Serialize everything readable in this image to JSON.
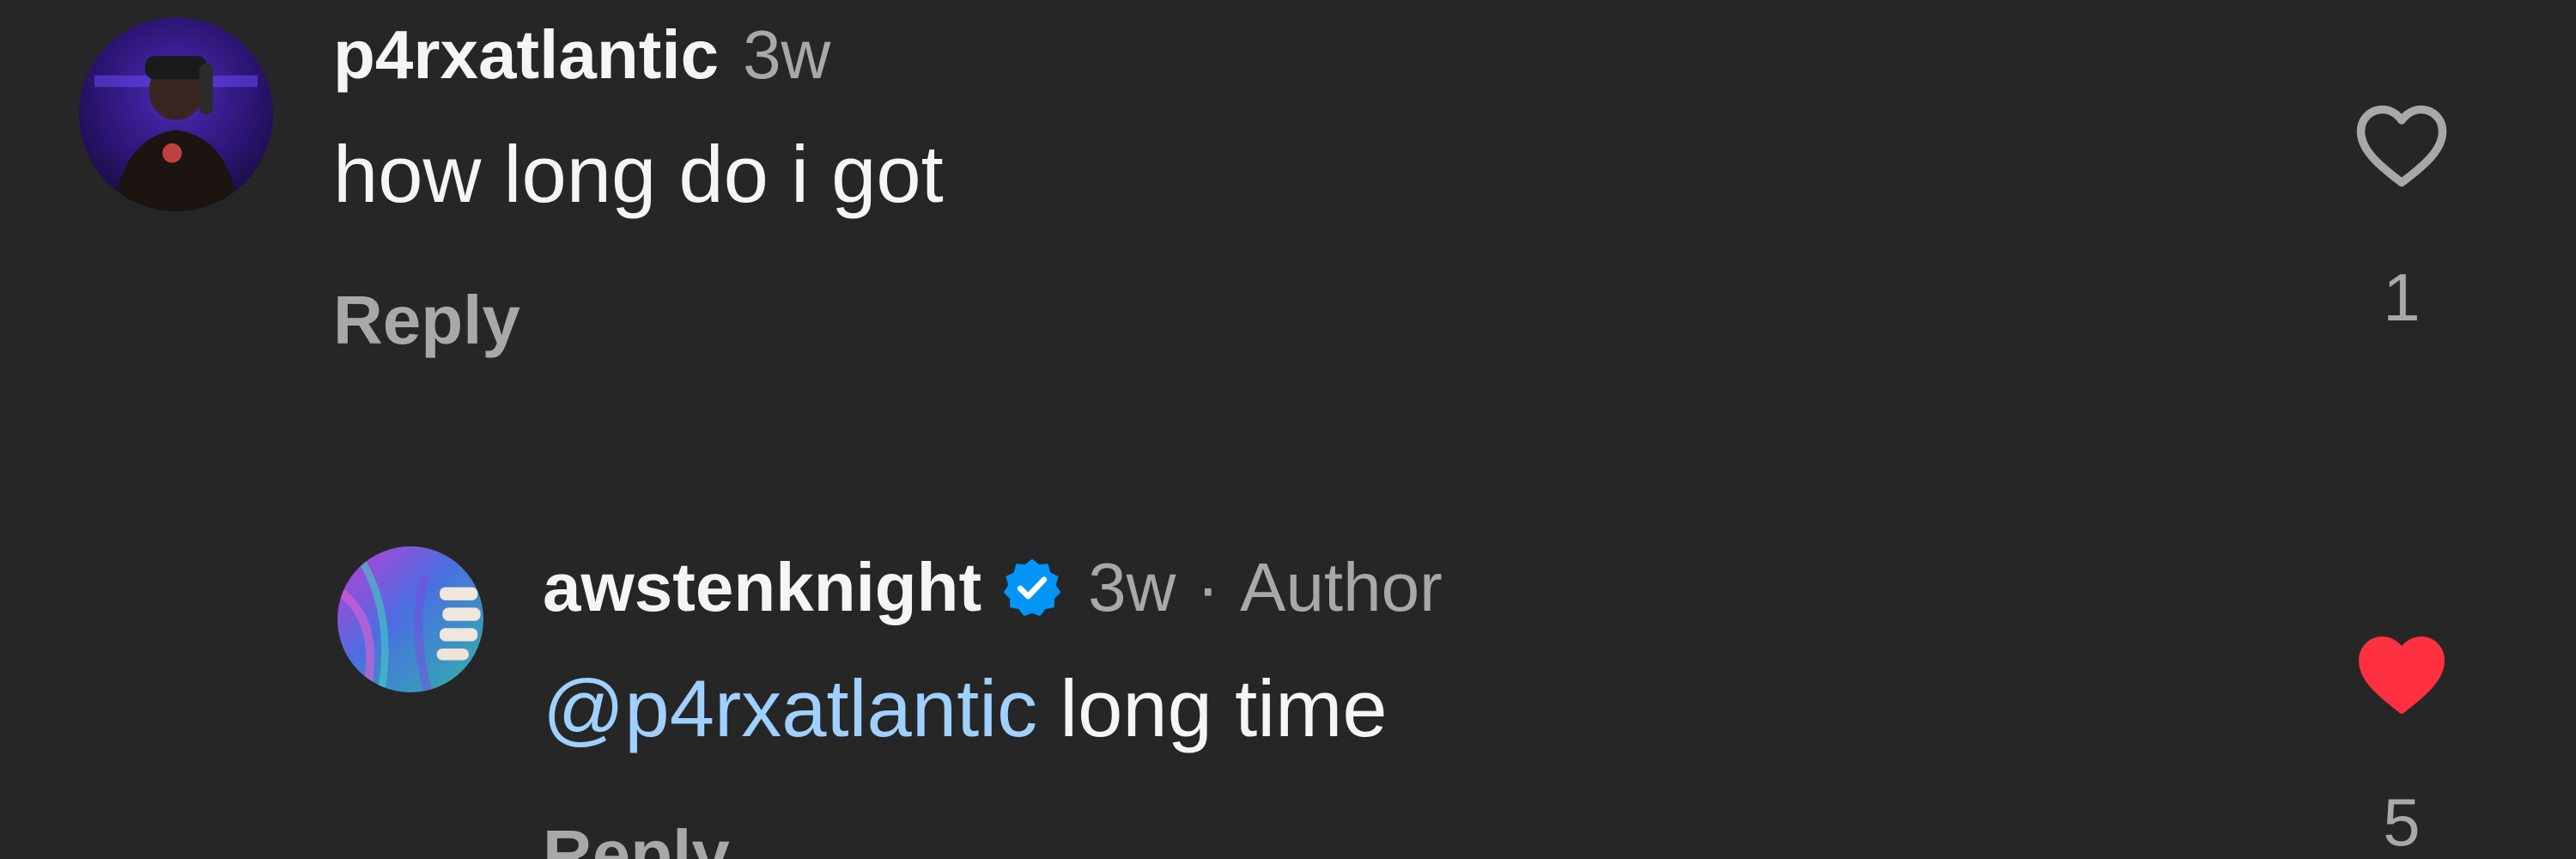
{
  "comments": [
    {
      "username": "p4rxatlantic",
      "time": "3w",
      "text": "how long do i got",
      "reply_label": "Reply",
      "like_count": "1",
      "liked": false,
      "avatar_icon": "user-avatar-photo"
    }
  ],
  "reply": {
    "username": "awstenknight",
    "verified": true,
    "time": "3w",
    "separator": "·",
    "author_label": "Author",
    "mention": "@p4rxatlantic",
    "text": " long time",
    "reply_label": "Reply",
    "like_count": "5",
    "liked": true,
    "avatar_icon": "user-avatar-photo"
  },
  "colors": {
    "background": "#262626",
    "mention": "#9fd0ff",
    "liked_heart": "#ff3040",
    "verified_badge": "#0095f6"
  }
}
